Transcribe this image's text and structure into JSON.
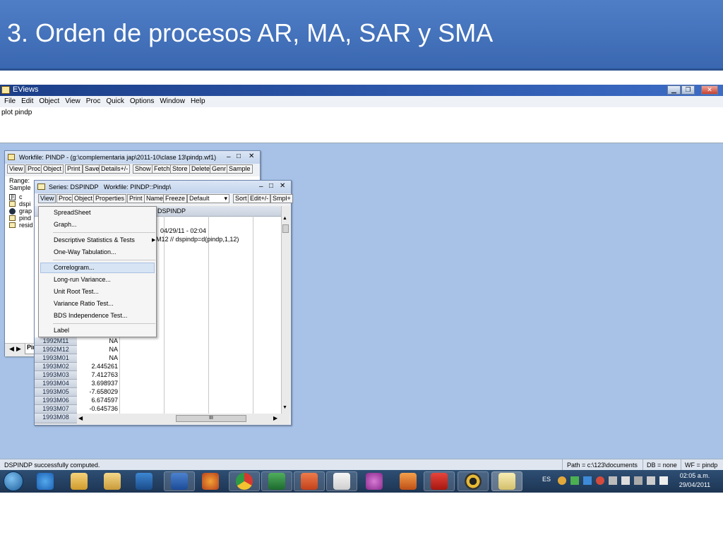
{
  "slide": {
    "title": "3. Orden de procesos AR, MA, SAR y SMA"
  },
  "app": {
    "title": "EViews",
    "menu": [
      "File",
      "Edit",
      "Object",
      "View",
      "Proc",
      "Quick",
      "Options",
      "Window",
      "Help"
    ],
    "command": "plot pindp"
  },
  "workfile": {
    "title": "Workfile: PINDP - (g:\\complementaria jap\\2011-10\\clase 13\\pindp.wf1)",
    "toolbar": [
      "View",
      "Proc",
      "Object",
      "Print",
      "Save",
      "Details+/-",
      "Show",
      "Fetch",
      "Store",
      "Delete",
      "Genr",
      "Sample"
    ],
    "range_label": "Range:",
    "sample_label": "Sample",
    "objects": [
      "c",
      "dspi",
      "grap",
      "pind",
      "resid"
    ],
    "tab": "Pin"
  },
  "series": {
    "title": "Series: DSPINDP   Workfile: PINDP::Pindp\\",
    "toolbar": [
      "View",
      "Proc",
      "Object",
      "Properties",
      "Print",
      "Name",
      "Freeze",
      "Default",
      "Sort",
      "Edit+/-",
      "Smpl+"
    ],
    "col_header": "DSPINDP",
    "note_line1": "04/29/11 - 02:04",
    "note_line2": "M12 // dspindp=d(pindp,1,12)",
    "rows": [
      {
        "date": "1992M11",
        "value": "NA"
      },
      {
        "date": "1992M12",
        "value": "NA"
      },
      {
        "date": "1993M01",
        "value": "NA"
      },
      {
        "date": "1993M02",
        "value": "2.445261"
      },
      {
        "date": "1993M03",
        "value": "7.412763"
      },
      {
        "date": "1993M04",
        "value": "3.698937"
      },
      {
        "date": "1993M05",
        "value": "-7.658029"
      },
      {
        "date": "1993M06",
        "value": "6.674597"
      },
      {
        "date": "1993M07",
        "value": "-0.645736"
      },
      {
        "date": "1993M08",
        "value": ""
      }
    ],
    "hscroll_label": "III"
  },
  "view_menu": {
    "items": [
      "SpreadSheet",
      "Graph...",
      "Descriptive Statistics & Tests",
      "One-Way Tabulation...",
      "Correlogram...",
      "Long-run Variance...",
      "Unit Root Test...",
      "Variance Ratio Test...",
      "BDS Independence Test...",
      "Label"
    ],
    "highlighted": "Correlogram..."
  },
  "statusbar": {
    "message": "DSPINDP successfully computed.",
    "path": "Path = c:\\123\\documents",
    "db": "DB = none",
    "wf": "WF = pindp"
  },
  "taskbar": {
    "lang": "ES",
    "time": "02:05 a.m.",
    "date": "29/04/2011"
  }
}
